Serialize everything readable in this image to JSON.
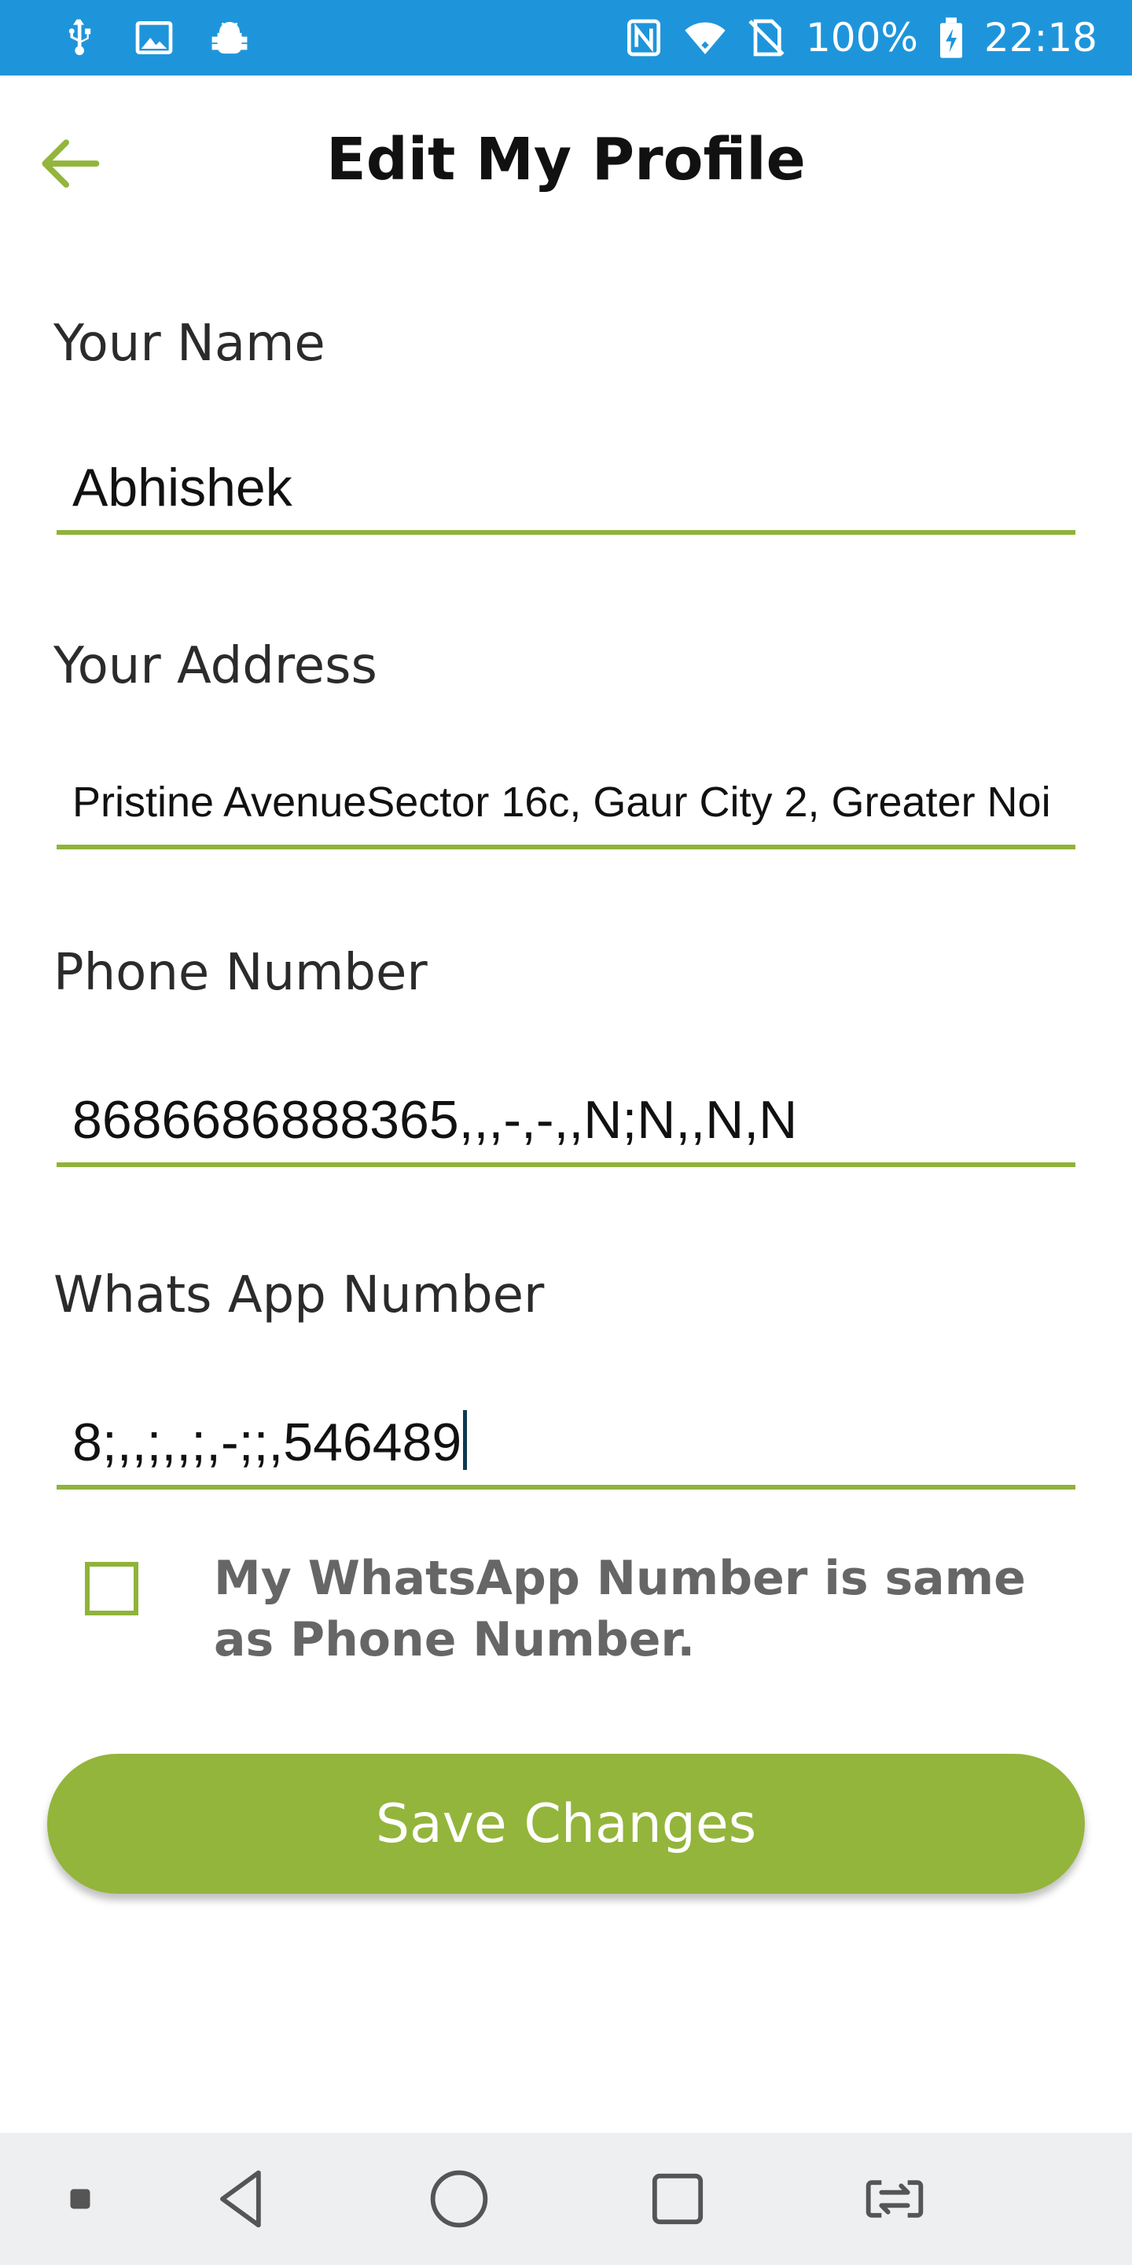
{
  "status_bar": {
    "battery_percent": "100%",
    "time": "22:18",
    "left_icons": [
      "usb-icon",
      "image-icon",
      "android-debug-icon"
    ],
    "right_icons": [
      "nfc-icon",
      "wifi-icon",
      "no-sim-icon",
      "battery-charging-icon"
    ]
  },
  "header": {
    "title": "Edit My Profile",
    "back_icon": "arrow-left-icon"
  },
  "form": {
    "name": {
      "label": "Your Name",
      "value": "Abhishek"
    },
    "address": {
      "label": "Your Address",
      "value": "Pristine AvenueSector 16c, Gaur City 2, Greater Noi"
    },
    "phone": {
      "label": "Phone Number",
      "value": "8686686888365,,,-,-,,N;N,,N,N"
    },
    "whatsapp": {
      "label": "Whats App Number",
      "value": "8;,,;,,;,-;;,546489"
    },
    "same_number_checkbox": {
      "label": "My WhatsApp Number is same as Phone Number.",
      "checked": false
    }
  },
  "actions": {
    "save_label": "Save Changes"
  },
  "nav_bar": {
    "buttons": [
      "dot-icon",
      "back-triangle-icon",
      "home-circle-icon",
      "recents-square-icon",
      "switch-app-icon"
    ]
  },
  "colors": {
    "status_bar": "#1e95db",
    "accent_green": "#93b53b",
    "underline_green": "#8fb33a",
    "nav_bar": "#eeeff1"
  }
}
